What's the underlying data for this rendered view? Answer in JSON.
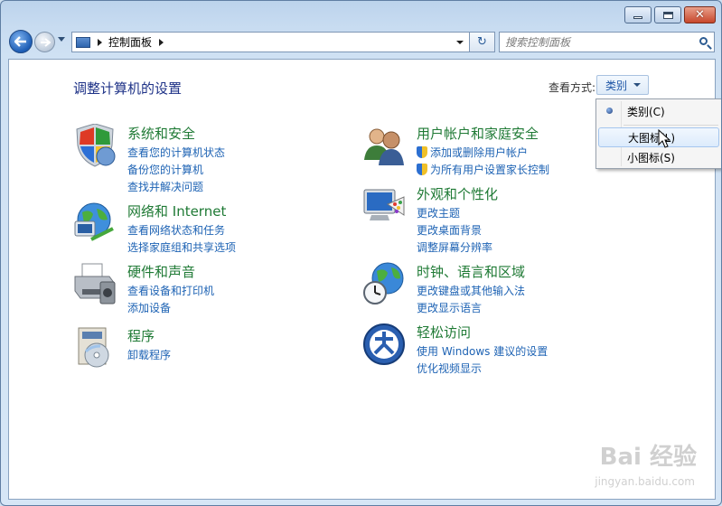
{
  "window": {
    "caption": {
      "minimize": "minimize",
      "maximize": "maximize",
      "close": "✕"
    }
  },
  "nav": {
    "breadcrumb": [
      "控制面板"
    ],
    "search_placeholder": "搜索控制面板",
    "refresh_glyph": "↻"
  },
  "header": {
    "title": "调整计算机的设置",
    "view_by_label": "查看方式:",
    "view_by_value": "类别"
  },
  "categories": [
    {
      "title": "系统和安全",
      "links": [
        {
          "text": "查看您的计算机状态"
        },
        {
          "text": "备份您的计算机"
        },
        {
          "text": "查找并解决问题"
        }
      ],
      "icon": "shield-icon"
    },
    {
      "title": "网络和 Internet",
      "links": [
        {
          "text": "查看网络状态和任务"
        },
        {
          "text": "选择家庭组和共享选项"
        }
      ],
      "icon": "globe-network-icon"
    },
    {
      "title": "硬件和声音",
      "links": [
        {
          "text": "查看设备和打印机"
        },
        {
          "text": "添加设备"
        }
      ],
      "icon": "printer-icon"
    },
    {
      "title": "程序",
      "links": [
        {
          "text": "卸载程序"
        }
      ],
      "icon": "programs-icon"
    },
    {
      "title": "用户帐户和家庭安全",
      "links": [
        {
          "text": "添加或删除用户帐户",
          "uac": true
        },
        {
          "text": "为所有用户设置家长控制",
          "uac": true
        }
      ],
      "icon": "users-icon"
    },
    {
      "title": "外观和个性化",
      "links": [
        {
          "text": "更改主题"
        },
        {
          "text": "更改桌面背景"
        },
        {
          "text": "调整屏幕分辨率"
        }
      ],
      "icon": "monitor-palette-icon"
    },
    {
      "title": "时钟、语言和区域",
      "links": [
        {
          "text": "更改键盘或其他输入法"
        },
        {
          "text": "更改显示语言"
        }
      ],
      "icon": "clock-globe-icon"
    },
    {
      "title": "轻松访问",
      "links": [
        {
          "text": "使用 Windows 建议的设置"
        },
        {
          "text": "优化视频显示"
        }
      ],
      "icon": "ease-of-access-icon"
    }
  ],
  "view_menu": {
    "items": [
      {
        "label": "类别(C)",
        "selected": true
      },
      {
        "label": "大图标(L)",
        "highlighted": true
      },
      {
        "label": "小图标(S)"
      }
    ]
  },
  "watermark": {
    "text": "Bai 经验",
    "sub": "jingyan.baidu.com"
  }
}
